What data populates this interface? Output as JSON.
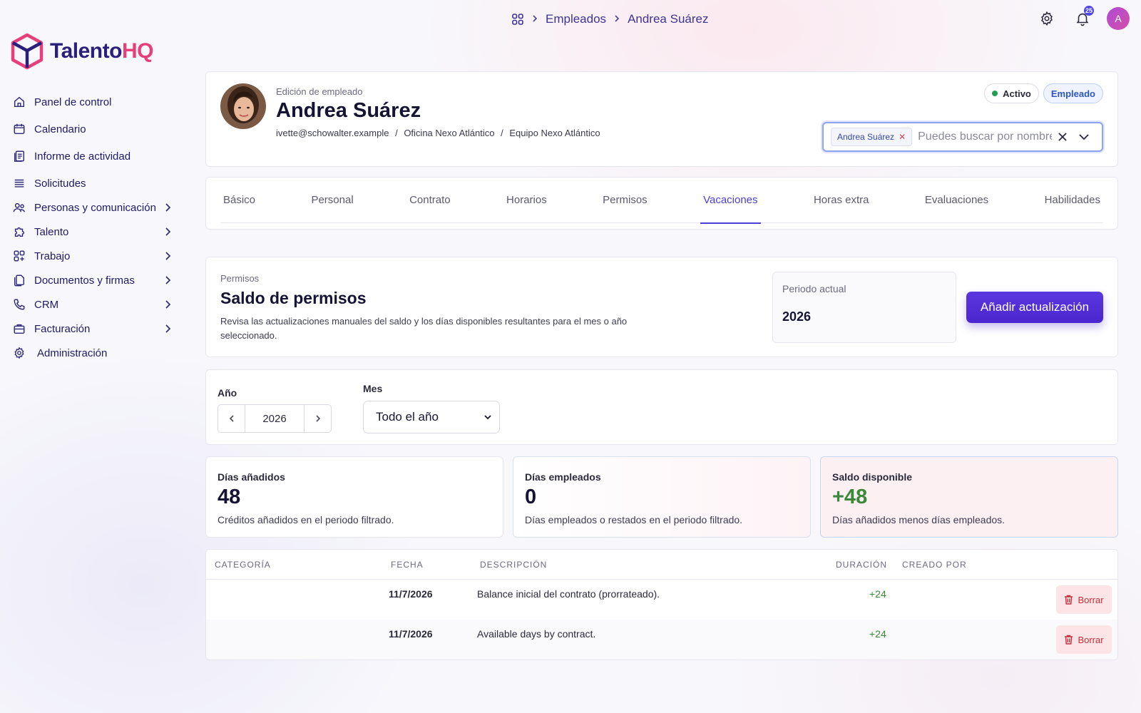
{
  "breadcrumb": {
    "level1": "Empleados",
    "level2": "Andrea Suárez"
  },
  "topbar": {
    "notification_count": "25",
    "avatar_initial": "A"
  },
  "brand": {
    "part1": "Talento",
    "part2": "HQ"
  },
  "sidebar": {
    "items": [
      {
        "label": "Panel de control",
        "icon": "home-icon"
      },
      {
        "label": "Calendario",
        "icon": "calendar-icon"
      },
      {
        "label": "Informe de actividad",
        "icon": "report-icon"
      },
      {
        "label": "Solicitudes",
        "icon": "list-icon"
      },
      {
        "label": "Personas y comunicación",
        "icon": "people-icon"
      },
      {
        "label": "Talento",
        "icon": "puzzle-icon"
      },
      {
        "label": "Trabajo",
        "icon": "grid-icon"
      },
      {
        "label": "Documentos y firmas",
        "icon": "documents-icon"
      },
      {
        "label": "CRM",
        "icon": "phone-icon"
      },
      {
        "label": "Facturación",
        "icon": "briefcase-icon"
      },
      {
        "label": "Administración",
        "icon": "gear-icon"
      }
    ]
  },
  "employee": {
    "subtitle": "Edición de empleado",
    "name": "Andrea Suárez",
    "email": "ivette@schowalter.example",
    "office": "Oficina Nexo Atlántico",
    "team": "Equipo Nexo Atlántico",
    "separator": "/",
    "status": "Activo",
    "role": "Empleado",
    "status_color": "#22a052"
  },
  "employee_selector": {
    "chip": "Andrea Suárez",
    "placeholder": "Puedes buscar por nombre"
  },
  "tabs": [
    {
      "label": "Básico"
    },
    {
      "label": "Personal"
    },
    {
      "label": "Contrato"
    },
    {
      "label": "Horarios"
    },
    {
      "label": "Permisos"
    },
    {
      "label": "Vacaciones",
      "active": true
    },
    {
      "label": "Horas extra"
    },
    {
      "label": "Evaluaciones"
    },
    {
      "label": "Habilidades"
    }
  ],
  "balance": {
    "kicker": "Permisos",
    "title": "Saldo de permisos",
    "description": "Revisa las actualizaciones manuales del saldo y los días disponibles resultantes para el mes o año seleccionado.",
    "period_label": "Periodo actual",
    "period_value": "2026",
    "add_button": "Añadir actualización"
  },
  "filters": {
    "year_label": "Año",
    "year_value": "2026",
    "month_label": "Mes",
    "month_value": "Todo el año"
  },
  "stats": [
    {
      "label": "Días añadidos",
      "value": "48",
      "note": "Créditos añadidos en el periodo filtrado."
    },
    {
      "label": "Días empleados",
      "value": "0",
      "note": "Días empleados o restados en el periodo filtrado."
    },
    {
      "label": "Saldo disponible",
      "value": "+48",
      "note": "Días añadidos menos días empleados."
    }
  ],
  "table": {
    "columns": [
      "CATEGORÍA",
      "FECHA",
      "DESCRIPCIÓN",
      "DURACIÓN",
      "CREADO POR"
    ],
    "rows": [
      {
        "category": "",
        "date": "11/7/2026",
        "description": "Balance inicial del contrato (prorrateado).",
        "duration": "+24",
        "created_by": "",
        "action": "Borrar"
      },
      {
        "category": "",
        "date": "11/7/2026",
        "description": "Available days by contract.",
        "duration": "+24",
        "created_by": "",
        "action": "Borrar"
      }
    ]
  },
  "colors": {
    "accent": "#4a3ed6",
    "positive": "#3b8a3b",
    "danger": "#c2303e",
    "brand_pink": "#e5407a",
    "brand_navy": "#2a1f7a"
  }
}
